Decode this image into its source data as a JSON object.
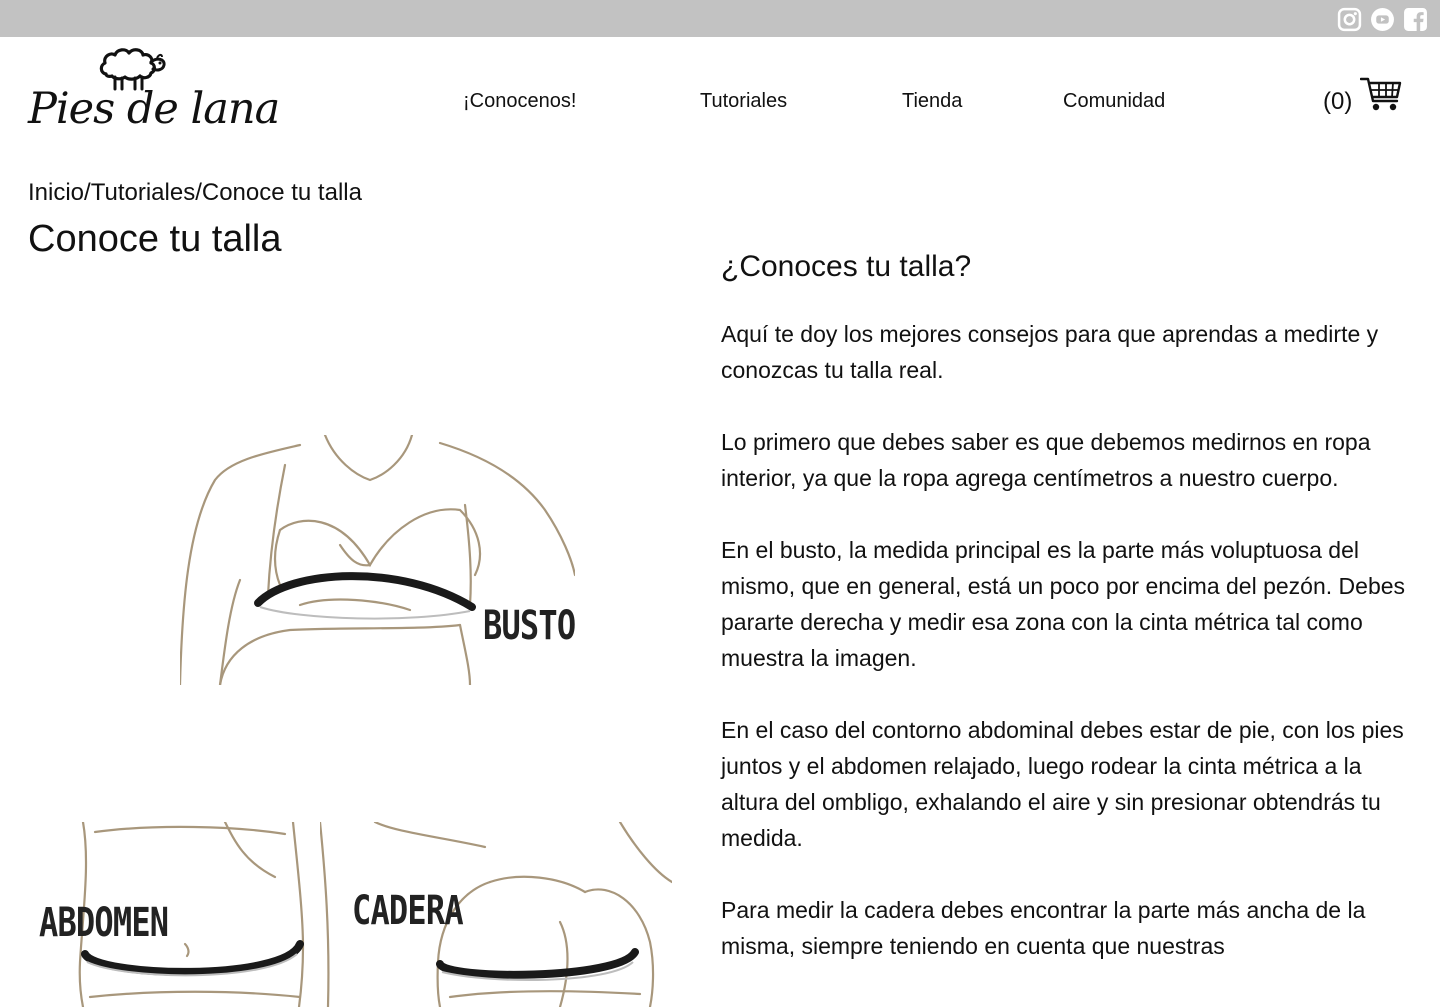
{
  "topbar": {
    "social": [
      {
        "icon": "instagram-icon",
        "label": "Instagram"
      },
      {
        "icon": "youtube-icon",
        "label": "YouTube"
      },
      {
        "icon": "facebook-icon",
        "label": "Facebook"
      }
    ]
  },
  "header": {
    "logo_text": "Pies de lana",
    "nav": [
      "¡Conocenos!",
      "Tutoriales",
      "Tienda",
      "Comunidad"
    ],
    "cart_count": "(0)",
    "cart_icon": "cart-icon"
  },
  "breadcrumb": {
    "items": [
      "Inicio",
      "Tutoriales",
      "Conoce tu talla"
    ],
    "separator": "/"
  },
  "page_title": "Conoce tu talla",
  "figures": {
    "busto_label": "BUSTO",
    "abdomen_label": "ABDOMEN",
    "cadera_label": "CADERA"
  },
  "article": {
    "heading": "¿Conoces tu talla?",
    "paragraphs": [
      "Aquí te doy los mejores consejos para que aprendas a medirte y conozcas tu talla real.",
      "Lo primero que debes saber es que debemos medirnos en ropa interior, ya que la ropa agrega centímetros a nuestro cuerpo.",
      "En el busto, la medida principal es la parte más voluptuosa del mismo, que en general, está un poco por encima del pezón. Debes pararte derecha y medir esa zona con la cinta métrica tal como muestra la imagen.",
      "En el caso del contorno abdominal debes estar de pie, con los pies juntos y el abdomen relajado, luego rodear la cinta métrica a la altura del ombligo, exhalando el aire y sin presionar obtendrás tu medida.",
      "Para medir la cadera debes encontrar la parte más ancha de la misma, siempre teniendo en cuenta que nuestras"
    ]
  },
  "colors": {
    "topbar": "#c2c2c2",
    "sketch": "#a8977c",
    "tape": "#1a1a1a"
  }
}
